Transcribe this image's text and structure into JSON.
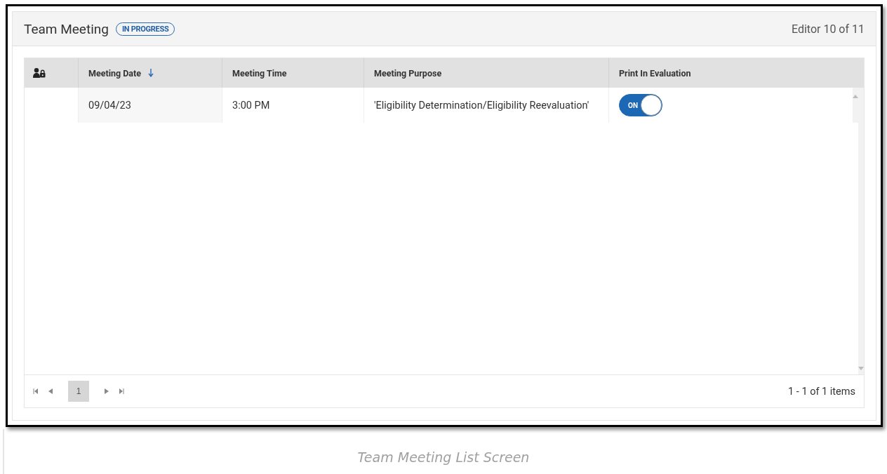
{
  "panel": {
    "title": "Team Meeting",
    "status_badge": "IN PROGRESS",
    "editor_count": "Editor 10 of 11"
  },
  "table": {
    "columns": [
      {
        "kind": "icon",
        "sorted": false
      },
      {
        "kind": "text",
        "label": "Meeting Date",
        "sorted": true
      },
      {
        "kind": "text",
        "label": "Meeting Time",
        "sorted": false
      },
      {
        "kind": "text",
        "label": "Meeting Purpose",
        "sorted": false
      },
      {
        "kind": "text",
        "label": "Print In Evaluation",
        "sorted": false
      }
    ],
    "rows": [
      {
        "meeting_date": "09/04/23",
        "meeting_time": "3:00 PM",
        "meeting_purpose": "'Eligibility Determination/Eligibility Reevaluation'",
        "print_in_evaluation": {
          "label": "ON",
          "on": true
        }
      }
    ]
  },
  "pager": {
    "pages": [
      {
        "label": "1",
        "selected": true
      }
    ],
    "summary": "1 - 1 of 1 items"
  },
  "caption": "Team Meeting List Screen"
}
